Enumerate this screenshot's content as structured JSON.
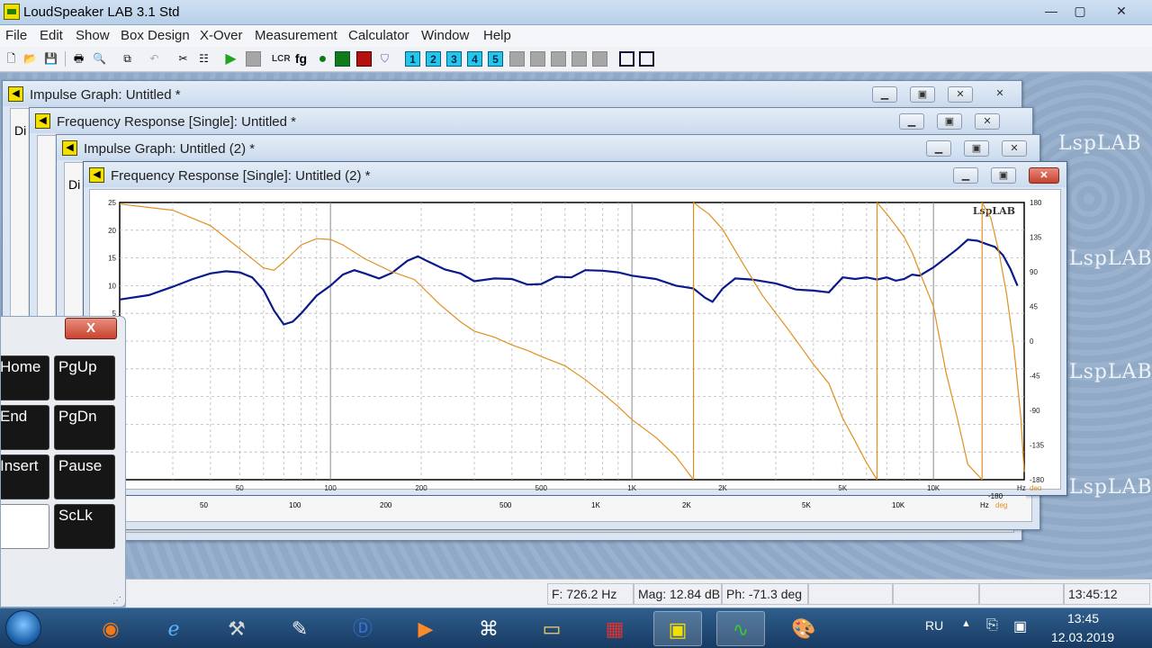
{
  "app": {
    "title": "LoudSpeaker LAB 3.1 Std"
  },
  "window_controls": {
    "minimize": "—",
    "restore": "▢",
    "close": "✕"
  },
  "menu": [
    "File",
    "Edit",
    "Show",
    "Box Design",
    "X-Over",
    "Measurement",
    "Calculator",
    "Window",
    "Help"
  ],
  "toolbar": {
    "buttons": [
      "new-icon",
      "open-icon",
      "save-icon",
      "print-icon",
      "preview-icon",
      "copy-icon",
      "undo-icon",
      "tools-icon",
      "mixer-icon",
      "play-icon",
      "stop-icon",
      "lcr-icon",
      "fg-icon",
      "green-dot-icon",
      "green-box-icon",
      "red-box-icon",
      "badge-icon"
    ],
    "number_buttons": [
      "1",
      "2",
      "3",
      "4",
      "5"
    ],
    "fg_label": "fg",
    "lcr_label": "LCR"
  },
  "windows": [
    {
      "title": "Impulse Graph: Untitled *"
    },
    {
      "title": "Frequency Response [Single]: Untitled *"
    },
    {
      "title": "Impulse Graph: Untitled (2) *"
    },
    {
      "title": "Frequency Response [Single]: Untitled (2) *"
    }
  ],
  "partial_label": "Di",
  "watermark": "LspLAB",
  "background_graph": {
    "xticks": [
      "50",
      "100",
      "200",
      "500",
      "1K",
      "2K",
      "5K",
      "10K"
    ],
    "unit_hz": "Hz",
    "unit_deg": "deg",
    "phase_min": "-180"
  },
  "chart_data": {
    "type": "line",
    "title": "",
    "xlabel": "Hz",
    "ylabel": "",
    "y2label": "deg",
    "logo": "LspLAB",
    "xscale": "log",
    "xlim": [
      20,
      20000
    ],
    "ylim": [
      -25,
      25
    ],
    "y2lim": [
      -180,
      180
    ],
    "grid": true,
    "xticks": [
      {
        "v": 50,
        "l": "50"
      },
      {
        "v": 100,
        "l": "100"
      },
      {
        "v": 200,
        "l": "200"
      },
      {
        "v": 500,
        "l": "500"
      },
      {
        "v": 1000,
        "l": "1K"
      },
      {
        "v": 2000,
        "l": "2K"
      },
      {
        "v": 5000,
        "l": "5K"
      },
      {
        "v": 10000,
        "l": "10K"
      }
    ],
    "yticks": [
      "25",
      "20",
      "15",
      "10",
      "5"
    ],
    "y2ticks": [
      "180",
      "135",
      "90",
      "45",
      "0",
      "-45",
      "-90",
      "-135",
      "-180"
    ],
    "series": [
      {
        "axis": "left",
        "color": "#0a1a8c",
        "points": [
          [
            20,
            7.5
          ],
          [
            25,
            8.3
          ],
          [
            30,
            9.8
          ],
          [
            35,
            11.2
          ],
          [
            40,
            12.2
          ],
          [
            45,
            12.6
          ],
          [
            50,
            12.4
          ],
          [
            55,
            11.5
          ],
          [
            60,
            9.2
          ],
          [
            65,
            5.5
          ],
          [
            70,
            3
          ],
          [
            75,
            3.5
          ],
          [
            80,
            5
          ],
          [
            90,
            8.2
          ],
          [
            100,
            10
          ],
          [
            110,
            12
          ],
          [
            120,
            12.8
          ],
          [
            130,
            12.2
          ],
          [
            145,
            11.3
          ],
          [
            160,
            12.3
          ],
          [
            180,
            14.5
          ],
          [
            195,
            15.3
          ],
          [
            210,
            14.4
          ],
          [
            240,
            12.9
          ],
          [
            270,
            12.2
          ],
          [
            300,
            10.8
          ],
          [
            350,
            11.3
          ],
          [
            400,
            11.2
          ],
          [
            450,
            10.2
          ],
          [
            500,
            10.3
          ],
          [
            560,
            11.6
          ],
          [
            630,
            11.5
          ],
          [
            700,
            12.8
          ],
          [
            800,
            12.7
          ],
          [
            900,
            12.4
          ],
          [
            1000,
            11.8
          ],
          [
            1200,
            11.2
          ],
          [
            1400,
            10
          ],
          [
            1600,
            9.5
          ],
          [
            1750,
            7.8
          ],
          [
            1850,
            7.1
          ],
          [
            2000,
            9.5
          ],
          [
            2200,
            11.3
          ],
          [
            2500,
            11.1
          ],
          [
            3000,
            10.4
          ],
          [
            3500,
            9.3
          ],
          [
            4000,
            9.1
          ],
          [
            4500,
            8.8
          ],
          [
            5000,
            11.5
          ],
          [
            5500,
            11.2
          ],
          [
            6000,
            11.5
          ],
          [
            6500,
            11.1
          ],
          [
            7000,
            11.5
          ],
          [
            7500,
            10.9
          ],
          [
            8000,
            11.2
          ],
          [
            8500,
            12
          ],
          [
            9000,
            11.8
          ],
          [
            10000,
            13.3
          ],
          [
            12000,
            16.6
          ],
          [
            13000,
            18.3
          ],
          [
            14000,
            18.1
          ],
          [
            15000,
            17.5
          ],
          [
            16000,
            17
          ],
          [
            17000,
            15.5
          ],
          [
            18000,
            13
          ],
          [
            19000,
            10
          ]
        ]
      },
      {
        "axis": "right",
        "color": "#e0901e",
        "segments": [
          [
            [
              20,
              178
            ],
            [
              30,
              170
            ],
            [
              40,
              150
            ],
            [
              50,
              120
            ],
            [
              60,
              95
            ],
            [
              65,
              92
            ],
            [
              70,
              103
            ],
            [
              80,
              125
            ],
            [
              90,
              133
            ],
            [
              100,
              132
            ],
            [
              110,
              125
            ],
            [
              130,
              107
            ],
            [
              160,
              90
            ],
            [
              190,
              80
            ],
            [
              230,
              48
            ],
            [
              270,
              25
            ],
            [
              300,
              13
            ],
            [
              350,
              5
            ],
            [
              400,
              -5
            ],
            [
              450,
              -12
            ],
            [
              500,
              -20
            ],
            [
              600,
              -32
            ],
            [
              700,
              -50
            ],
            [
              800,
              -68
            ],
            [
              900,
              -85
            ],
            [
              1000,
              -102
            ],
            [
              1200,
              -125
            ],
            [
              1400,
              -150
            ],
            [
              1600,
              -180
            ]
          ],
          [
            [
              1600,
              180
            ],
            [
              1700,
              172
            ],
            [
              1800,
              165
            ],
            [
              2000,
              145
            ],
            [
              2300,
              105
            ],
            [
              2700,
              60
            ],
            [
              3300,
              15
            ],
            [
              4000,
              -30
            ],
            [
              4500,
              -55
            ],
            [
              5000,
              -100
            ],
            [
              5500,
              -130
            ],
            [
              6000,
              -158
            ],
            [
              6500,
              -180
            ]
          ],
          [
            [
              6500,
              180
            ],
            [
              7000,
              165
            ],
            [
              7500,
              150
            ],
            [
              8000,
              135
            ],
            [
              8500,
              115
            ],
            [
              9000,
              90
            ],
            [
              10000,
              45
            ],
            [
              11000,
              -40
            ],
            [
              12000,
              -100
            ],
            [
              13000,
              -160
            ],
            [
              14500,
              -180
            ]
          ],
          [
            [
              14500,
              180
            ],
            [
              15500,
              160
            ],
            [
              16500,
              115
            ],
            [
              17500,
              60
            ],
            [
              18500,
              -10
            ],
            [
              19500,
              -100
            ],
            [
              20000,
              -170
            ]
          ]
        ]
      }
    ]
  },
  "keyboard": {
    "close": "X",
    "keys": [
      "Home",
      "PgUp",
      "End",
      "PgDn",
      "Insert",
      "Pause",
      "",
      "ScLk"
    ]
  },
  "status": {
    "freq": "F: 726.2 Hz",
    "mag": "Mag: 12.84 dB",
    "phase": "Ph: -71.3 deg",
    "time": "13:45:12"
  },
  "taskbar": {
    "apps": [
      "firefox-icon",
      "ie-icon",
      "tools-icon",
      "pen-icon",
      "d-icon",
      "play-icon",
      "fox-icon",
      "folder-icon",
      "floppy-icon",
      "lsplab-icon",
      "scope-icon",
      "paint-icon"
    ],
    "lang": "RU",
    "clock_time": "13:45",
    "clock_date": "12.03.2019"
  }
}
